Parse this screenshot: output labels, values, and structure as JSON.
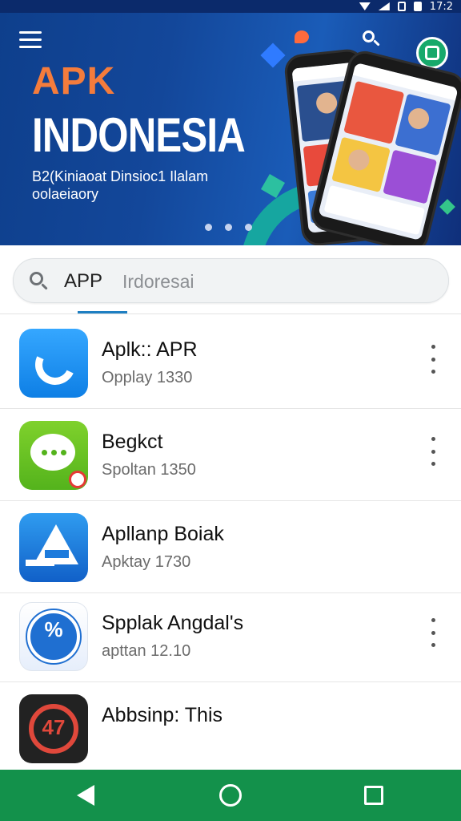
{
  "status_bar": {
    "time": "17:2"
  },
  "banner": {
    "logo_text": "APK",
    "title": "INDONESIA",
    "subtitle_line1": "B2(Kiniaoat Dinsioc1 Ilalam",
    "subtitle_line2": "oolaeiaory",
    "carousel_dots": 3
  },
  "search": {
    "query": "APP",
    "placeholder": "Irdoresai"
  },
  "apps": [
    {
      "name": "Aplk:: APR",
      "meta": "Opplay 1330"
    },
    {
      "name": "Begkct",
      "meta": "Spoltan 1350"
    },
    {
      "name": "Apllanp Boiak",
      "meta": "Apktay 1730"
    },
    {
      "name": "Spplak Angdal's",
      "meta": "apttan 12.10"
    },
    {
      "name": "Abbsinp: This",
      "meta": ""
    }
  ],
  "icon_glyphs": {
    "percent": "%",
    "red": "47"
  },
  "colors": {
    "banner_bg": "#13479a",
    "logo": "#f47c3c",
    "nav_bar": "#13914b",
    "accent": "#1e7fc2"
  },
  "icons": [
    "menu-icon",
    "search-icon",
    "chat-bubble-icon",
    "profile-badge-icon",
    "more-vert-icon",
    "back-icon",
    "home-icon",
    "recents-icon"
  ]
}
